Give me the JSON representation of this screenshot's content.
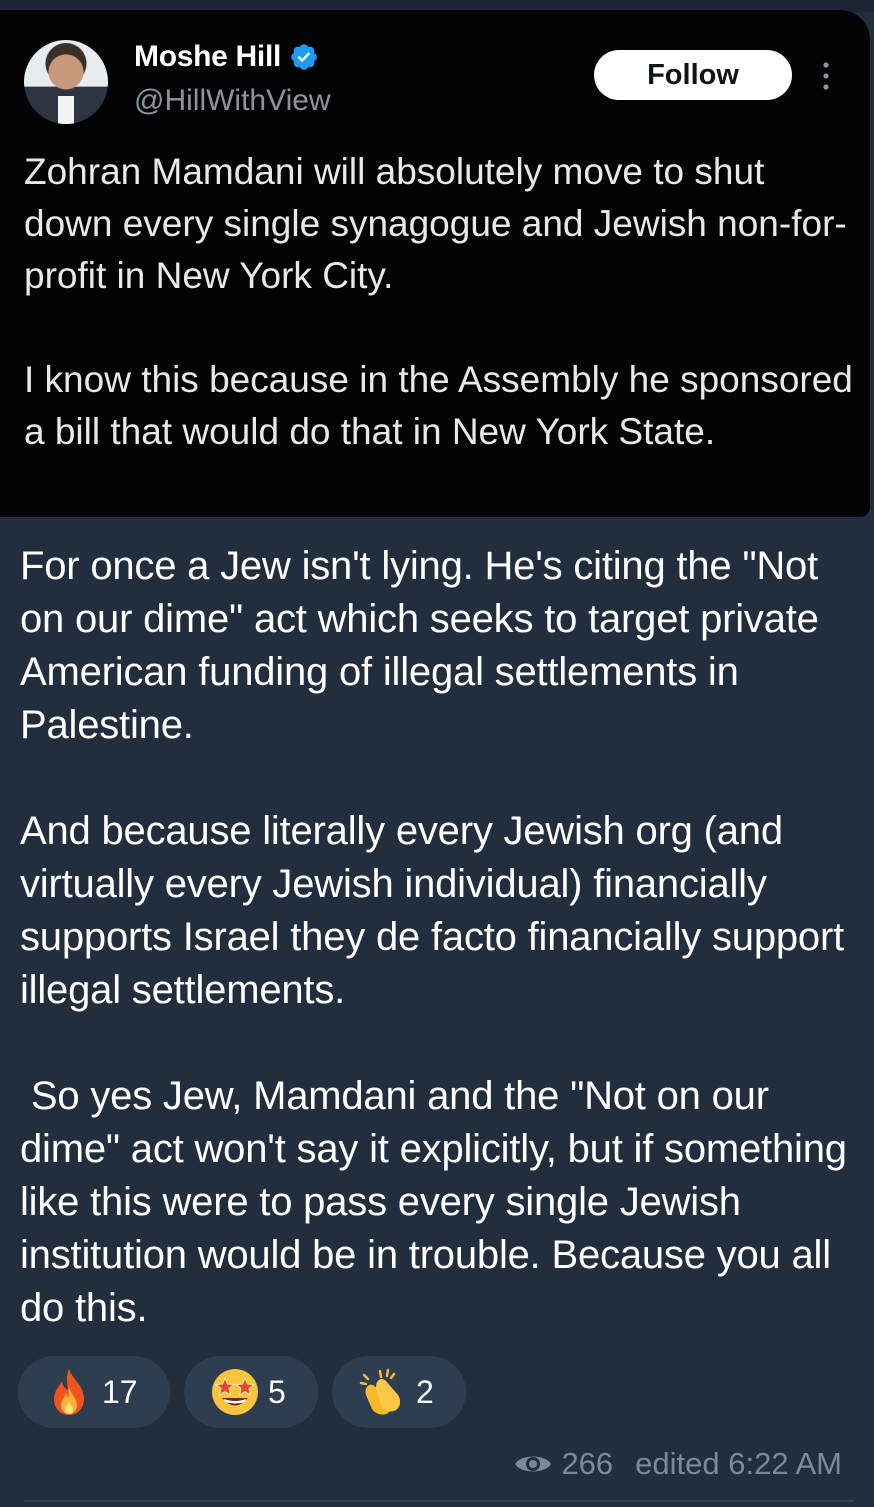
{
  "tweet": {
    "display_name": "Moshe Hill",
    "handle": "@HillWithView",
    "follow_label": "Follow",
    "paragraphs": [
      "Zohran Mamdani will absolutely move to shut down every single synagogue and Jewish non-for-profit in New York City.",
      "I know this because in the Assembly he sponsored a bill that would do that in New York State."
    ]
  },
  "message": {
    "paragraphs": [
      "For once a Jew isn't lying. He's citing the \"Not on our dime\" act which seeks to target private American funding of illegal settlements in Palestine.",
      "And because literally every Jewish org (and virtually every Jewish individual) financially supports Israel they de facto financially support illegal settlements.",
      " So yes Jew, Mamdani and the \"Not on our dime\" act won't say it explicitly, but if something like this were to pass every single Jewish institution would be in trouble. Because you all do this."
    ]
  },
  "reactions": [
    {
      "icon": "fire-emoji",
      "count": "17"
    },
    {
      "icon": "star-struck-emoji",
      "count": "5"
    },
    {
      "icon": "clapping-hands-emoji",
      "count": "2"
    }
  ],
  "meta": {
    "views": "266",
    "edited": "edited 6:22 AM"
  },
  "colors": {
    "background": "#222e3d",
    "tweet_background": "#040406",
    "verified_blue": "#1d9bf0",
    "reaction_pill": "#2e3d50",
    "meta_text": "#7b8a9b"
  }
}
